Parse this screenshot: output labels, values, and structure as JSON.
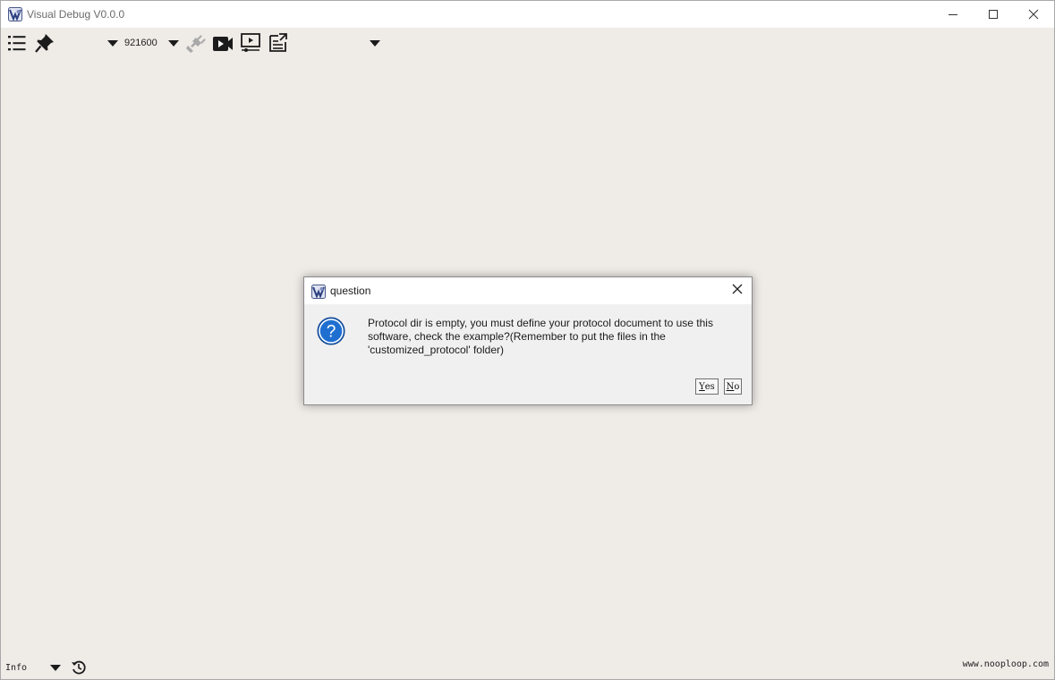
{
  "window": {
    "title": "Visual Debug V0.0.0",
    "icons": [
      "app-logo-icon",
      "minimize-icon",
      "maximize-icon",
      "close-icon"
    ]
  },
  "toolbar": {
    "baud_rate": "921600",
    "icons": [
      "menu-list-icon",
      "pin-icon",
      "port-dropdown-icon",
      "baud-dropdown-icon",
      "connect-plug-icon",
      "record-video-icon",
      "playback-screen-icon",
      "export-icon",
      "more-dropdown-icon"
    ]
  },
  "dialog": {
    "title": "question",
    "message": "Protocol dir is empty, you must define your protocol document to use this software, check the example?(Remember to put the files in the 'customized_protocol' folder)",
    "yes_label_accel": "Y",
    "yes_label_rest": "es",
    "no_label_accel": "N",
    "no_label_rest": "o",
    "icons": [
      "app-logo-icon",
      "close-icon",
      "question-icon"
    ]
  },
  "statusbar": {
    "log_level": "Info",
    "website": "www.nooploop.com",
    "icons": [
      "log-level-dropdown-icon",
      "history-icon"
    ]
  },
  "colors": {
    "background": "#efebe7",
    "titlebar": "#ffffff",
    "question_blue": "#1a66c4",
    "icon_dark": "#1b1b1b"
  }
}
